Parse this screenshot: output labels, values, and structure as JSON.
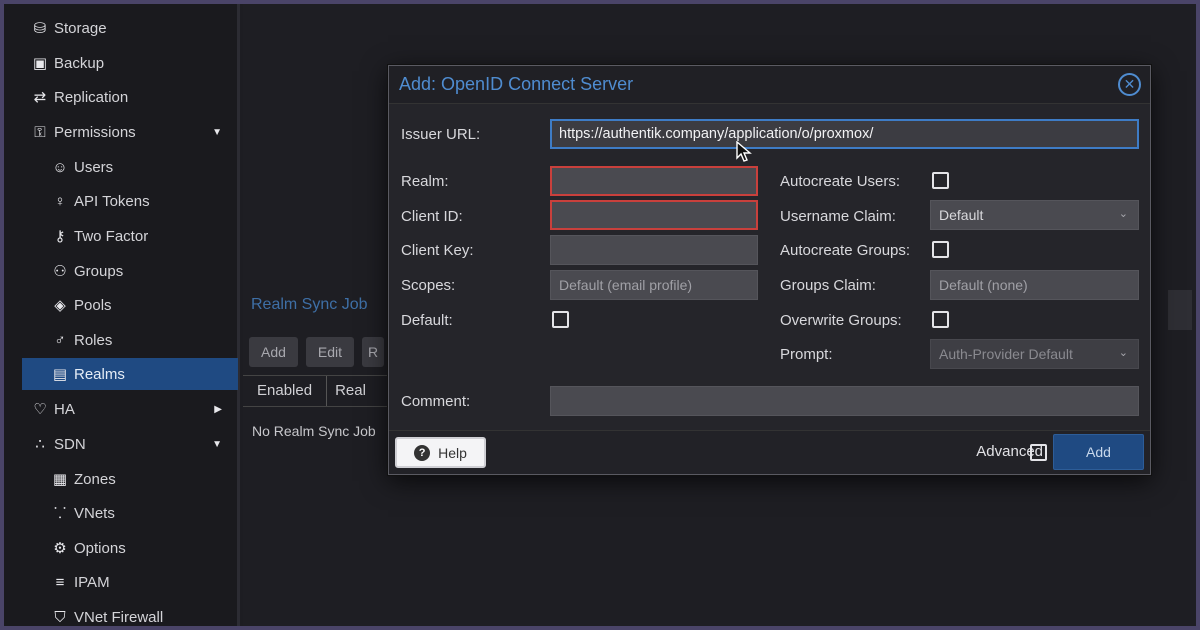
{
  "sidebar": {
    "items": [
      {
        "label": "Storage",
        "icon": "database-icon",
        "glyph": "⛁"
      },
      {
        "label": "Backup",
        "icon": "floppy-icon",
        "glyph": "▣"
      },
      {
        "label": "Replication",
        "icon": "refresh-icon",
        "glyph": "⇄"
      },
      {
        "label": "Permissions",
        "icon": "unlock-icon",
        "glyph": "⚿",
        "caret": "▼"
      },
      {
        "label": "Users",
        "icon": "user-icon",
        "glyph": "☺"
      },
      {
        "label": "API Tokens",
        "icon": "user-outline-icon",
        "glyph": "♀"
      },
      {
        "label": "Two Factor",
        "icon": "key-icon",
        "glyph": "⚷"
      },
      {
        "label": "Groups",
        "icon": "users-icon",
        "glyph": "⚇"
      },
      {
        "label": "Pools",
        "icon": "tags-icon",
        "glyph": "◈"
      },
      {
        "label": "Roles",
        "icon": "male-icon",
        "glyph": "♂"
      },
      {
        "label": "Realms",
        "icon": "address-book-icon",
        "glyph": "▤"
      },
      {
        "label": "HA",
        "icon": "heartbeat-icon",
        "glyph": "♡",
        "caret": "▶"
      },
      {
        "label": "SDN",
        "icon": "sdn-icon",
        "glyph": "∴",
        "caret": "▼"
      },
      {
        "label": "Zones",
        "icon": "grid-icon",
        "glyph": "▦"
      },
      {
        "label": "VNets",
        "icon": "network-icon",
        "glyph": "⸪"
      },
      {
        "label": "Options",
        "icon": "gear-icon",
        "glyph": "⚙"
      },
      {
        "label": "IPAM",
        "icon": "ipam-icon",
        "glyph": "≡"
      },
      {
        "label": "VNet Firewall",
        "icon": "shield-icon",
        "glyph": "⛉"
      }
    ]
  },
  "background": {
    "panel_title": "Realm Sync Job",
    "toolbar": [
      "Add",
      "Edit",
      "R"
    ],
    "columns": [
      "Enabled",
      "Real"
    ],
    "empty_text": "No Realm Sync Job"
  },
  "dialog": {
    "title": "Add: OpenID Connect Server",
    "close_glyph": "✕",
    "issuer_url": {
      "label": "Issuer URL:",
      "value": "https://authentik.company/application/o/proxmox/"
    },
    "realm": {
      "label": "Realm:",
      "value": ""
    },
    "client_id": {
      "label": "Client ID:",
      "value": ""
    },
    "client_key": {
      "label": "Client Key:",
      "value": ""
    },
    "scopes": {
      "label": "Scopes:",
      "placeholder": "Default (email profile)"
    },
    "default": {
      "label": "Default:"
    },
    "autocreate_users": {
      "label": "Autocreate Users:"
    },
    "username_claim": {
      "label": "Username Claim:",
      "value": "Default"
    },
    "autocreate_groups": {
      "label": "Autocreate Groups:"
    },
    "groups_claim": {
      "label": "Groups Claim:",
      "placeholder": "Default (none)"
    },
    "overwrite_groups": {
      "label": "Overwrite Groups:"
    },
    "prompt": {
      "label": "Prompt:",
      "value": "Auth-Provider Default"
    },
    "comment": {
      "label": "Comment:",
      "value": ""
    },
    "footer": {
      "help": "Help",
      "advanced": "Advanced",
      "add": "Add"
    }
  },
  "colors": {
    "accent": "#1f4a82",
    "title": "#4f8cd0",
    "invalid": "#c9403c",
    "focus": "#3e7cc6"
  }
}
